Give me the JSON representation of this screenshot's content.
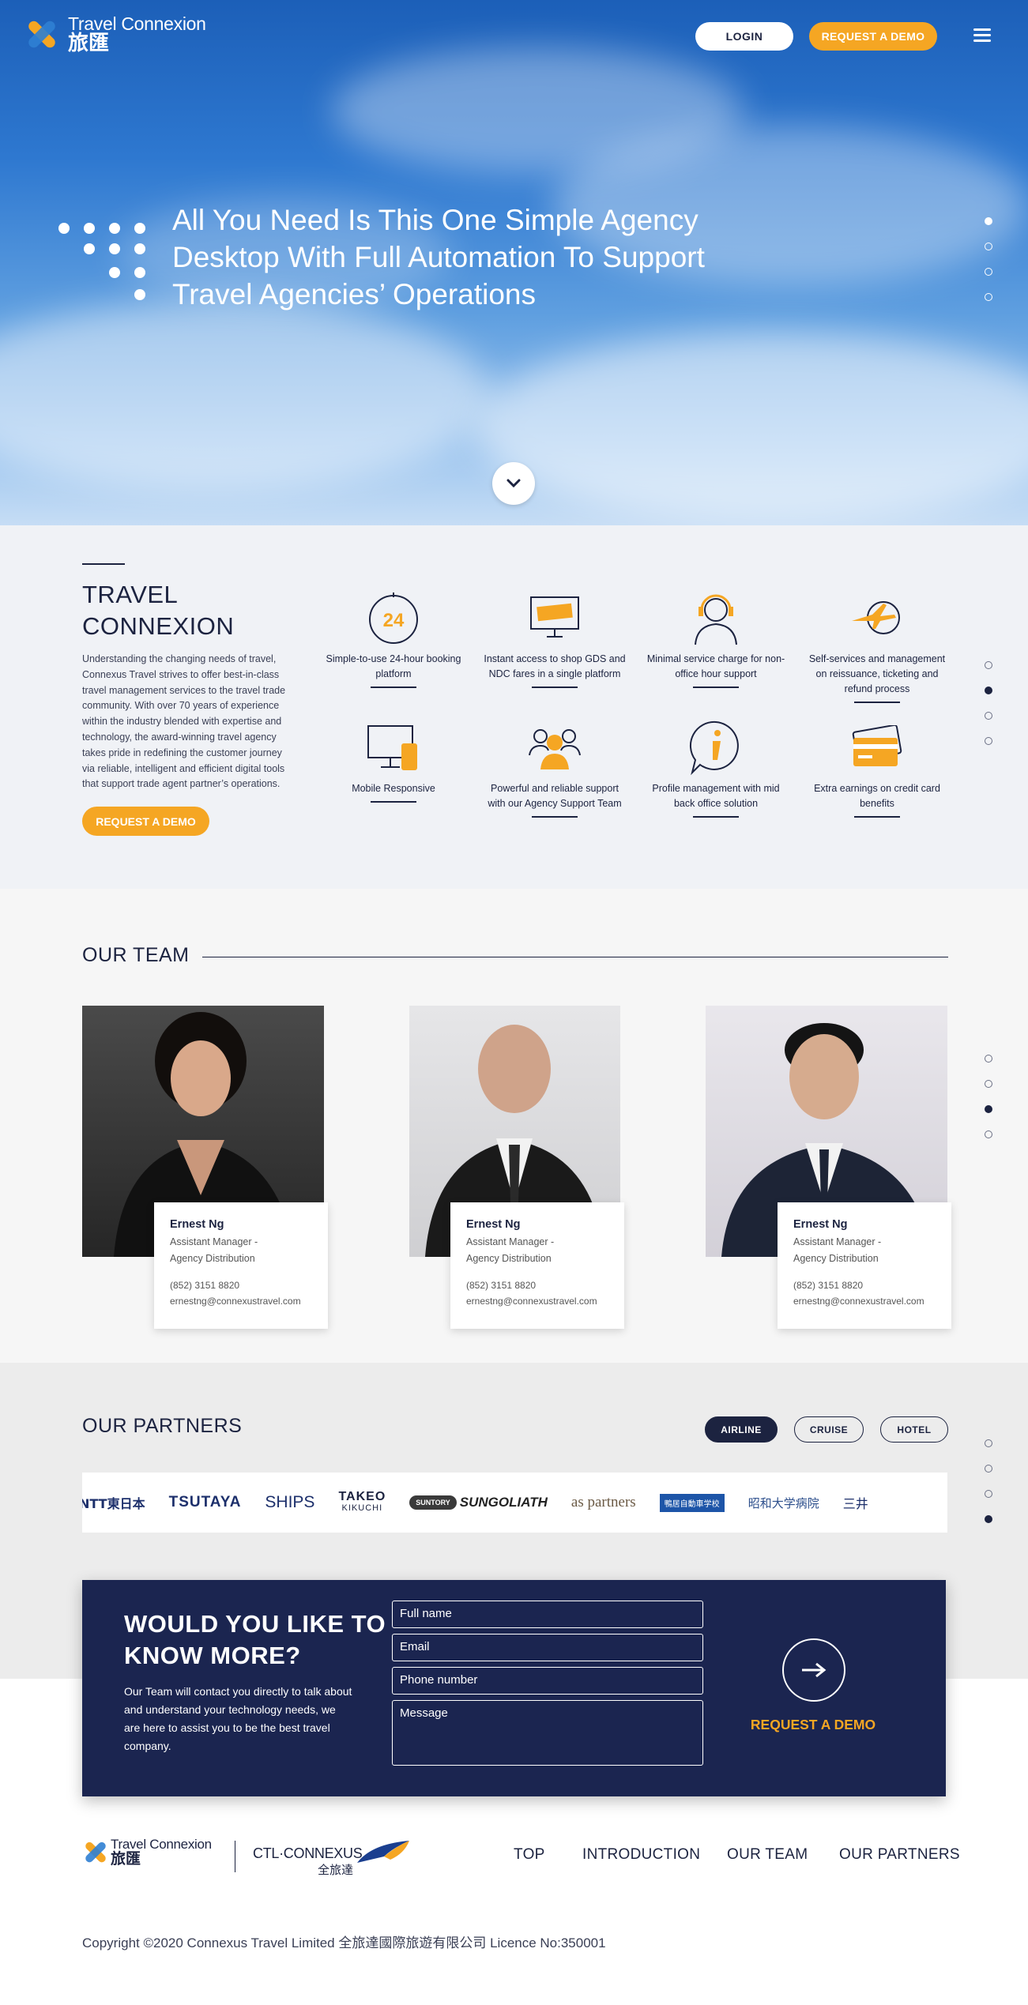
{
  "header": {
    "brand_en": "Travel Connexion",
    "brand_cn": "旅匯",
    "login_label": "LOGIN",
    "demo_label": "REQUEST A DEMO"
  },
  "hero": {
    "headline": "All You Need Is This One Simple Agency Desktop With Full Automation To Support Travel Agencies’ Operations"
  },
  "about": {
    "title_line1": "TRAVEL",
    "title_line2": "CONNEXION",
    "description": "Understanding the changing needs of travel, Connexus Travel strives to offer best-in-class travel management services to the travel trade community. With over 70 years of experience within the industry blended with expertise and technology, the award-winning travel agency takes pride in redefining the customer journey via reliable, intelligent and efficient digital tools that support trade agent partner’s operations.",
    "button_label": "REQUEST A DEMO",
    "features": [
      {
        "label": "Simple-to-use 24-hour booking platform",
        "icon": "clock-24-icon"
      },
      {
        "label": "Instant access to shop GDS and NDC fares in a single platform",
        "icon": "monitor-ticket-icon"
      },
      {
        "label": "Minimal service charge for non-office hour support",
        "icon": "headset-icon"
      },
      {
        "label": "Self-services and management on reissuance, ticketing and refund process",
        "icon": "plane-globe-icon"
      },
      {
        "label": "Mobile Responsive",
        "icon": "devices-icon"
      },
      {
        "label": "Powerful and reliable support with our Agency Support Team",
        "icon": "team-icon"
      },
      {
        "label": "Profile management with mid back office solution",
        "icon": "info-bubble-icon"
      },
      {
        "label": "Extra earnings on credit card benefits",
        "icon": "credit-card-icon"
      }
    ]
  },
  "team": {
    "title": "OUR TEAM",
    "members": [
      {
        "name": "Ernest Ng",
        "role_line1": "Assistant Manager -",
        "role_line2": "Agency Distribution",
        "phone": "(852) 3151 8820",
        "email": "ernestng@connexustravel.com"
      },
      {
        "name": "Ernest Ng",
        "role_line1": "Assistant Manager -",
        "role_line2": "Agency Distribution",
        "phone": "(852) 3151 8820",
        "email": "ernestng@connexustravel.com"
      },
      {
        "name": "Ernest Ng",
        "role_line1": "Assistant Manager -",
        "role_line2": "Agency Distribution",
        "phone": "(852) 3151 8820",
        "email": "ernestng@connexustravel.com"
      }
    ]
  },
  "partners": {
    "title": "OUR PARTNERS",
    "tabs": [
      "AIRLINE",
      "CRUISE",
      "HOTEL"
    ],
    "active_tab": "AIRLINE",
    "logos": [
      "NTT東日本",
      "TSUTAYA",
      "SHIPS",
      "TAKEO",
      "KIKUCHI",
      "SUNTORY",
      "SUNGOLIATH",
      "as partners",
      "鴨居自動車学校",
      "昭和大学病院",
      "三井"
    ]
  },
  "contact": {
    "title_line1": "WOULD YOU LIKE TO",
    "title_line2": "KNOW MORE?",
    "text": "Our Team will contact you directly to talk about and understand your technology needs, we are here to assist you to be the best travel company.",
    "fullname_placeholder": "Full name",
    "email_placeholder": "Email",
    "phone_placeholder": "Phone number",
    "message_placeholder": "Message",
    "cta_label": "REQUEST A DEMO"
  },
  "footer": {
    "brand_en": "Travel Connexion",
    "brand_cn": "旅匯",
    "partner_brand": "CTL·CONNEXUS",
    "partner_brand_cn": "全旅達",
    "nav": [
      "TOP",
      "INTRODUCTION",
      "OUR TEAM",
      "OUR PARTNERS"
    ],
    "copyright": "Copyright ©2020 Connexus Travel Limited 全旅達國際旅遊有限公司 Licence No:350001"
  },
  "colors": {
    "accent": "#f5a623",
    "navy": "#1b2550",
    "sky": "#2e78d0"
  }
}
